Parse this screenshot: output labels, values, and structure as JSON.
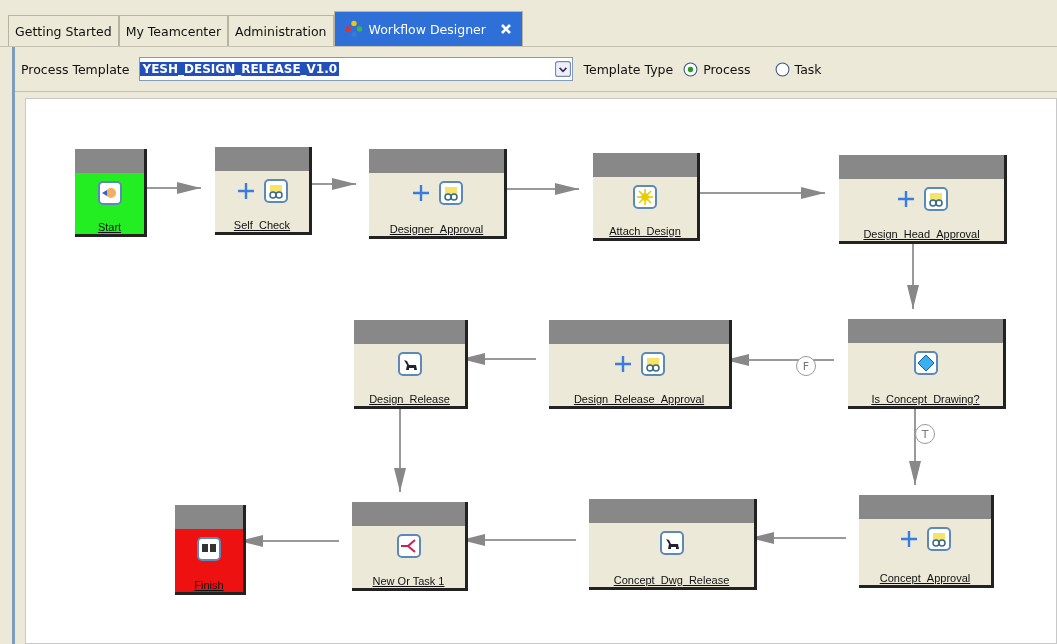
{
  "tabs": [
    {
      "label": "Getting Started",
      "selected": false
    },
    {
      "label": "My Teamcenter",
      "selected": false
    },
    {
      "label": "Administration",
      "selected": false
    },
    {
      "label": "Workflow Designer",
      "selected": true,
      "closable": true
    }
  ],
  "toolbar": {
    "template_label": "Process Template",
    "template_value": "YESH_DESIGN_RELEASE_V1.0",
    "type_label": "Template Type",
    "types": [
      {
        "label": "Process",
        "selected": true
      },
      {
        "label": "Task",
        "selected": false
      }
    ]
  },
  "nodes": [
    {
      "label": "Start",
      "kind": "start"
    },
    {
      "label": "Self_Check",
      "kind": "review"
    },
    {
      "label": "Designer_Approval",
      "kind": "review"
    },
    {
      "label": "Attach_Design",
      "kind": "task"
    },
    {
      "label": "Design_Head_Approval",
      "kind": "review"
    },
    {
      "label": "Design_Release",
      "kind": "status"
    },
    {
      "label": "Design_Release_Approval",
      "kind": "review"
    },
    {
      "label": "Is_Concept_Drawing?",
      "kind": "condition"
    },
    {
      "label": "Finish",
      "kind": "finish"
    },
    {
      "label": "New Or Task 1",
      "kind": "or"
    },
    {
      "label": "Concept_Dwg_Release",
      "kind": "status"
    },
    {
      "label": "Concept_Approval",
      "kind": "review"
    }
  ],
  "edge_labels": [
    "F",
    "T"
  ]
}
